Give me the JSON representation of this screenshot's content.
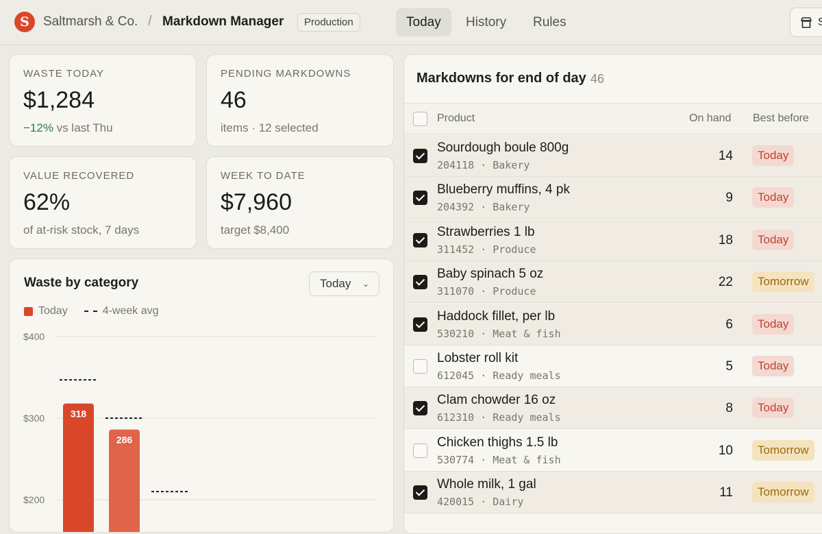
{
  "header": {
    "logo_letter": "S",
    "org": "Saltmarsh & Co.",
    "separator": "/",
    "app": "Markdown Manager",
    "env": "Production",
    "tabs": [
      {
        "label": "Today",
        "active": true
      },
      {
        "label": "History",
        "active": false
      },
      {
        "label": "Rules",
        "active": false
      }
    ],
    "store_button_label": "S"
  },
  "kpis": [
    {
      "label": "WASTE TODAY",
      "value": "$1,284",
      "delta": "−12%",
      "sub": "vs last Thu"
    },
    {
      "label": "PENDING MARKDOWNS",
      "value": "46",
      "sub": "items · 12 selected"
    },
    {
      "label": "VALUE RECOVERED",
      "value": "62%",
      "sub": "of at-risk stock, 7 days"
    },
    {
      "label": "WEEK TO DATE",
      "value": "$7,960",
      "sub": "target $8,400"
    }
  ],
  "waste_chart": {
    "title": "Waste by category",
    "range": "Today",
    "legend": {
      "today": "Today",
      "avg": "4-week avg"
    }
  },
  "chart_data": {
    "type": "bar",
    "title": "Waste by category",
    "series": [
      {
        "name": "Today",
        "values": [
          318,
          286
        ]
      },
      {
        "name": "4-week avg",
        "values": [
          347,
          300,
          210
        ]
      }
    ],
    "yticks": [
      "$400",
      "$300",
      "$200"
    ],
    "ytick_values": [
      400,
      300,
      200
    ],
    "ylim": [
      150,
      400
    ],
    "grid": true,
    "legend_position": "top-left",
    "colors": {
      "today_primary": "#d9472b",
      "today_secondary": "#e0644a",
      "avg": "#1f1f1c"
    }
  },
  "markdowns": {
    "title": "Markdowns for end of day",
    "count": "46",
    "columns": {
      "product": "Product",
      "on_hand": "On hand",
      "best_before": "Best before"
    },
    "rows": [
      {
        "name": "Sourdough boule 800g",
        "sku": "204118",
        "category": "Bakery",
        "qty": "14",
        "best_before": "Today",
        "checked": true
      },
      {
        "name": "Blueberry muffins, 4 pk",
        "sku": "204392",
        "category": "Bakery",
        "qty": "9",
        "best_before": "Today",
        "checked": true
      },
      {
        "name": "Strawberries 1 lb",
        "sku": "311452",
        "category": "Produce",
        "qty": "18",
        "best_before": "Today",
        "checked": true
      },
      {
        "name": "Baby spinach 5 oz",
        "sku": "311070",
        "category": "Produce",
        "qty": "22",
        "best_before": "Tomorrow",
        "checked": true
      },
      {
        "name": "Haddock fillet, per lb",
        "sku": "530210",
        "category": "Meat & fish",
        "qty": "6",
        "best_before": "Today",
        "checked": true
      },
      {
        "name": "Lobster roll kit",
        "sku": "612045",
        "category": "Ready meals",
        "qty": "5",
        "best_before": "Today",
        "checked": false
      },
      {
        "name": "Clam chowder 16 oz",
        "sku": "612310",
        "category": "Ready meals",
        "qty": "8",
        "best_before": "Today",
        "checked": true
      },
      {
        "name": "Chicken thighs 1.5 lb",
        "sku": "530774",
        "category": "Meat & fish",
        "qty": "10",
        "best_before": "Tomorrow",
        "checked": false
      },
      {
        "name": "Whole milk, 1 gal",
        "sku": "420015",
        "category": "Dairy",
        "qty": "11",
        "best_before": "Tomorrow",
        "checked": true
      }
    ]
  }
}
